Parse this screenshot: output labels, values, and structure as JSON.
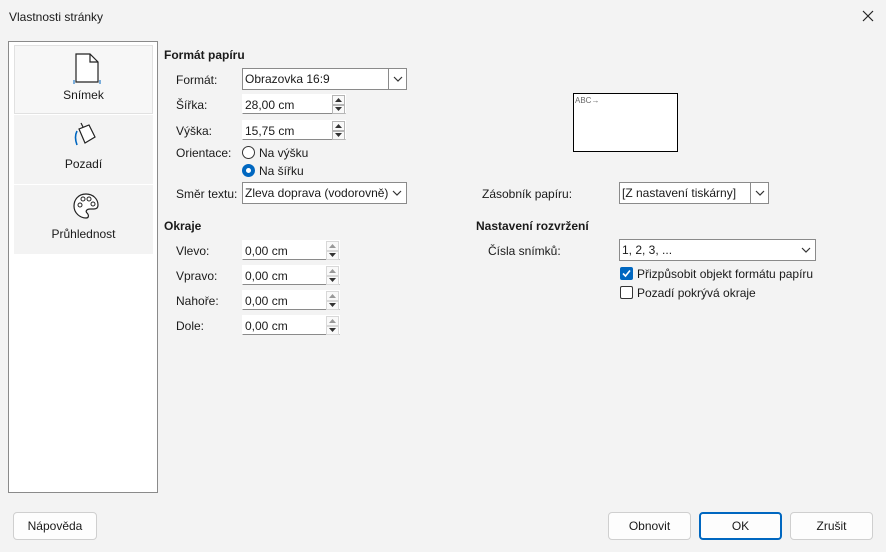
{
  "window": {
    "title": "Vlastnosti stránky"
  },
  "sidebar": {
    "items": [
      {
        "label": "Snímek",
        "icon": "page-icon",
        "active": true
      },
      {
        "label": "Pozadí",
        "icon": "paint-bucket-icon",
        "active": false
      },
      {
        "label": "Průhlednost",
        "icon": "palette-icon",
        "active": false
      }
    ]
  },
  "paper": {
    "heading": "Formát papíru",
    "format_label": "Formát:",
    "format_value": "Obrazovka 16:9",
    "width_label": "Šířka:",
    "width_value": "28,00 cm",
    "height_label": "Výška:",
    "height_value": "15,75 cm",
    "orientation_label": "Orientace:",
    "portrait_label": "Na výšku",
    "landscape_label": "Na šířku",
    "orientation_selected": "landscape",
    "textdir_label": "Směr textu:",
    "textdir_value": "Zleva doprava (vodorovně)",
    "tray_label": "Zásobník papíru:",
    "tray_value": "[Z nastavení tiskárny]",
    "preview_text": "ABC→"
  },
  "margins": {
    "heading": "Okraje",
    "left_label": "Vlevo:",
    "left_value": "0,00 cm",
    "right_label": "Vpravo:",
    "right_value": "0,00 cm",
    "top_label": "Nahoře:",
    "top_value": "0,00 cm",
    "bottom_label": "Dole:",
    "bottom_value": "0,00 cm"
  },
  "layout": {
    "heading": "Nastavení rozvržení",
    "numbers_label": "Čísla snímků:",
    "numbers_value": "1, 2, 3, ...",
    "fit_label": "Přizpůsobit objekt formátu papíru",
    "fit_checked": true,
    "bg_label": "Pozadí pokrývá okraje",
    "bg_checked": false
  },
  "buttons": {
    "help": "Nápověda",
    "reset": "Obnovit",
    "ok": "OK",
    "cancel": "Zrušit"
  },
  "colors": {
    "accent": "#0067c0"
  }
}
